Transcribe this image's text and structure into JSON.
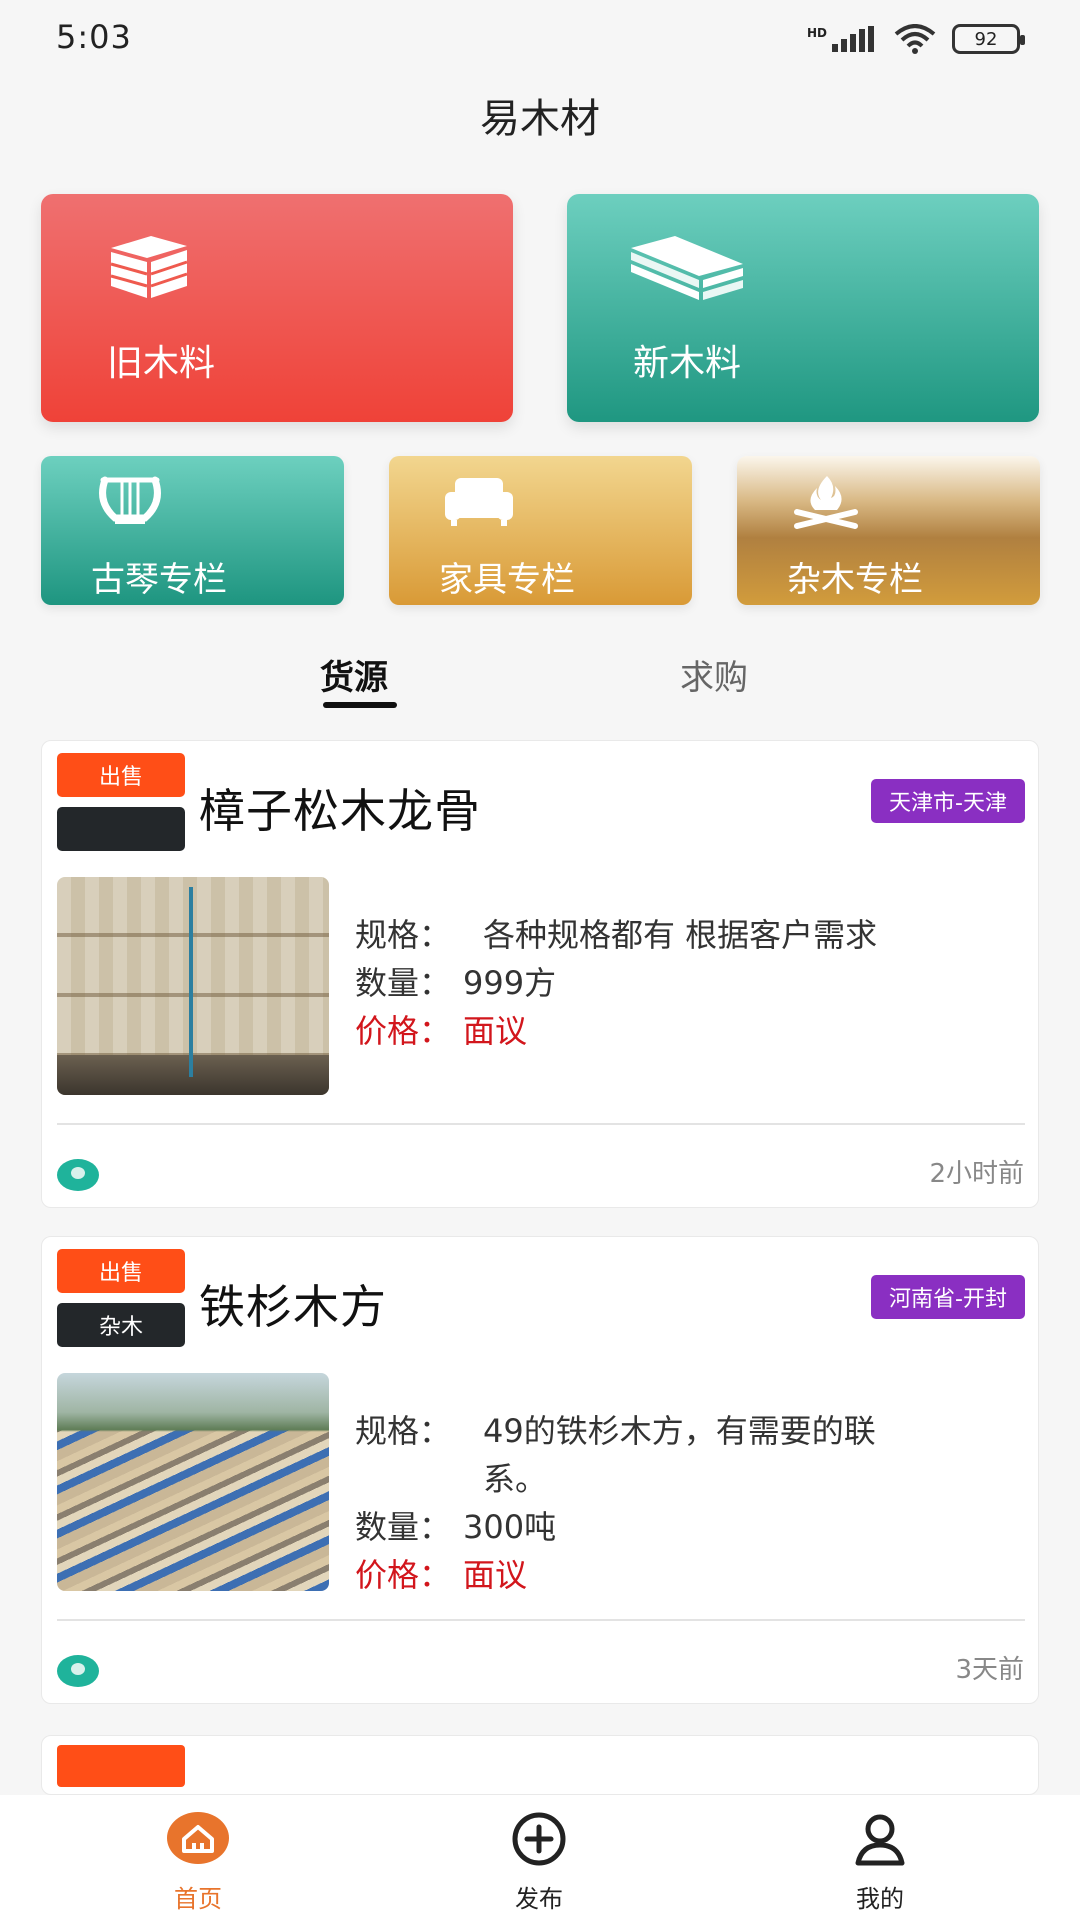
{
  "status_bar": {
    "time": "5:03",
    "network": "HD",
    "battery": "92"
  },
  "header": {
    "title": "易木材"
  },
  "categories": {
    "old_wood": "旧木料",
    "new_wood": "新木料",
    "guqin": "古琴专栏",
    "furniture": "家具专栏",
    "misc_wood": "杂木专栏"
  },
  "tabs": {
    "supply": "货源",
    "demand": "求购",
    "active": "supply"
  },
  "listings": [
    {
      "type_badge": "出售",
      "category_badge": "",
      "title": "樟子松木龙骨",
      "location": "天津市-天津",
      "spec_label": "规格：",
      "spec_value": "各种规格都有 根据客户需求",
      "qty_label": "数量：",
      "qty_value": "999方",
      "price_label": "价格：",
      "price_value": "面议",
      "time": "2小时前"
    },
    {
      "type_badge": "出售",
      "category_badge": "杂木",
      "title": "铁杉木方",
      "location": "河南省-开封",
      "spec_label": "规格：",
      "spec_value": "49的铁杉木方，有需要的联系。",
      "qty_label": "数量：",
      "qty_value": "300吨",
      "price_label": "价格：",
      "price_value": "面议",
      "time": "3天前"
    }
  ],
  "bottom_nav": {
    "home": "首页",
    "publish": "发布",
    "mine": "我的",
    "active": "home"
  },
  "colors": {
    "accent": "#e8742c",
    "sale_badge": "#ff4e17",
    "location_badge": "#8a2fc2",
    "price": "#d2161c"
  }
}
